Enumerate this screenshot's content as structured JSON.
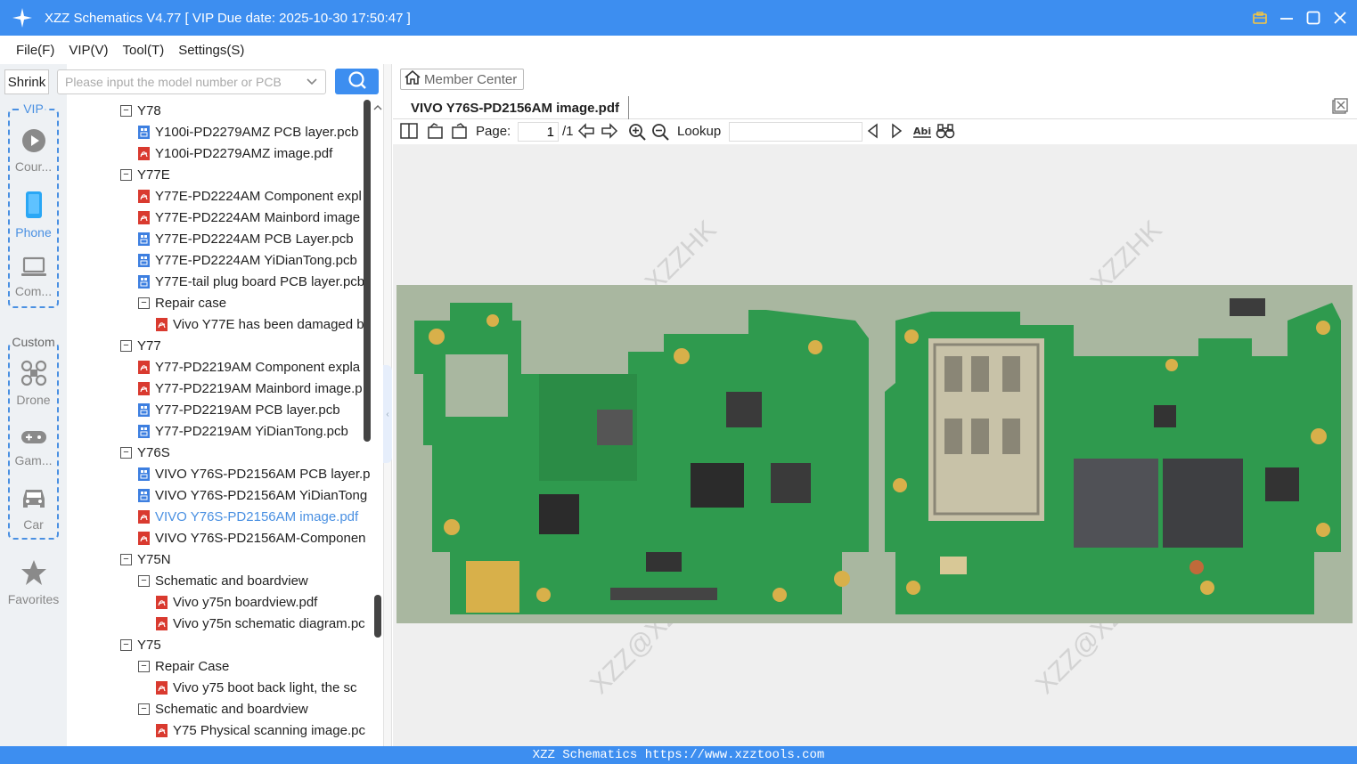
{
  "app": {
    "title": "XZZ Schematics V4.77 [ VIP Due date: 2025-10-30 17:50:47 ]",
    "accent": "#3d8ef0"
  },
  "menu": [
    "File(F)",
    "VIP(V)",
    "Tool(T)",
    "Settings(S)"
  ],
  "leftnav": {
    "shrink_label": "Shrink",
    "vip_group_label": "VIP",
    "custom_group_label": "Custom",
    "items": [
      {
        "label": "Cour...",
        "icon": "play-circle-icon"
      },
      {
        "label": "Phone",
        "icon": "phone-icon"
      },
      {
        "label": "Com...",
        "icon": "laptop-icon"
      },
      {
        "label": "Drone",
        "icon": "drone-icon"
      },
      {
        "label": "Gam...",
        "icon": "gamepad-icon"
      },
      {
        "label": "Car",
        "icon": "car-icon"
      },
      {
        "label": "Favorites",
        "icon": "star-icon"
      }
    ]
  },
  "search": {
    "placeholder": "Please input the model number or PCB",
    "value": ""
  },
  "tree": [
    {
      "label": "Y78",
      "level": 0,
      "kind": "folder"
    },
    {
      "label": "Y100i-PD2279AMZ PCB layer.pcb",
      "level": 1,
      "kind": "pcb"
    },
    {
      "label": "Y100i-PD2279AMZ image.pdf",
      "level": 1,
      "kind": "pdf"
    },
    {
      "label": "Y77E",
      "level": 0,
      "kind": "folder"
    },
    {
      "label": "Y77E-PD2224AM Component expl",
      "level": 1,
      "kind": "pdf"
    },
    {
      "label": "Y77E-PD2224AM Mainbord image",
      "level": 1,
      "kind": "pdf"
    },
    {
      "label": "Y77E-PD2224AM PCB Layer.pcb",
      "level": 1,
      "kind": "pcb"
    },
    {
      "label": "Y77E-PD2224AM YiDianTong.pcb",
      "level": 1,
      "kind": "pcb"
    },
    {
      "label": "Y77E-tail plug board PCB layer.pcb",
      "level": 1,
      "kind": "pcb"
    },
    {
      "label": "Repair case",
      "level": 1,
      "kind": "folder"
    },
    {
      "label": "Vivo Y77E has been damaged b",
      "level": 2,
      "kind": "pdf"
    },
    {
      "label": "Y77",
      "level": 0,
      "kind": "folder"
    },
    {
      "label": "Y77-PD2219AM Component expla",
      "level": 1,
      "kind": "pdf"
    },
    {
      "label": "Y77-PD2219AM Mainbord image.p",
      "level": 1,
      "kind": "pdf"
    },
    {
      "label": "Y77-PD2219AM PCB layer.pcb",
      "level": 1,
      "kind": "pcb"
    },
    {
      "label": "Y77-PD2219AM YiDianTong.pcb",
      "level": 1,
      "kind": "pcb"
    },
    {
      "label": "Y76S",
      "level": 0,
      "kind": "folder"
    },
    {
      "label": "VIVO Y76S-PD2156AM PCB layer.p",
      "level": 1,
      "kind": "pcb"
    },
    {
      "label": "VIVO Y76S-PD2156AM YiDianTong",
      "level": 1,
      "kind": "pcb"
    },
    {
      "label": "VIVO Y76S-PD2156AM image.pdf",
      "level": 1,
      "kind": "pdf",
      "selected": true
    },
    {
      "label": "VIVO Y76S-PD2156AM-Componen",
      "level": 1,
      "kind": "pdf"
    },
    {
      "label": "Y75N",
      "level": 0,
      "kind": "folder"
    },
    {
      "label": "Schematic and boardview",
      "level": 1,
      "kind": "folder"
    },
    {
      "label": "Vivo y75n boardview.pdf",
      "level": 2,
      "kind": "pdf"
    },
    {
      "label": "Vivo y75n schematic diagram.pc",
      "level": 2,
      "kind": "pdf"
    },
    {
      "label": "Y75",
      "level": 0,
      "kind": "folder"
    },
    {
      "label": "Repair Case",
      "level": 1,
      "kind": "folder"
    },
    {
      "label": "Vivo y75 boot back light, the sc",
      "level": 2,
      "kind": "pdf"
    },
    {
      "label": "Schematic and boardview",
      "level": 1,
      "kind": "folder"
    },
    {
      "label": "Y75 Physical scanning image.pc",
      "level": 2,
      "kind": "pdf"
    }
  ],
  "right": {
    "member_center": "Member Center",
    "tab_title": "VIVO Y76S-PD2156AM image.pdf",
    "page_label": "Page:",
    "page_value": "1",
    "page_total": "/1",
    "lookup_label": "Lookup",
    "lookup_value": ""
  },
  "watermark_text": "XZZ@XZZHK",
  "status": "XZZ Schematics https://www.xzztools.com"
}
